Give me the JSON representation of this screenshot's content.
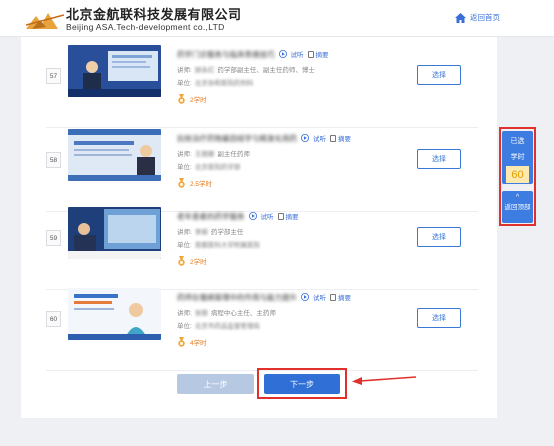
{
  "header": {
    "logo_cn": "北京金航联科技发展有限公司",
    "logo_en": "Beijing ASA.Tech-development co.,LTD",
    "home_label": "返回首页",
    "home_icon": "home-icon"
  },
  "courses": [
    {
      "number": "57",
      "title": "药学门诊服务与临床思维技巧",
      "trial_label": "试听",
      "handout_label": "摘要",
      "lecturer_label": "讲师:",
      "lecturer_name": "顾永红",
      "lecturer_title": "药学部副主任、副主任药师、博士",
      "unit_label": "单位:",
      "unit_name": "北京协和医院药剂科",
      "hours": "2学时",
      "select_label": "选择"
    },
    {
      "number": "58",
      "title": "抗栓治疗药物基因组学与精准化用药",
      "trial_label": "试听",
      "handout_label": "摘要",
      "lecturer_label": "讲师:",
      "lecturer_name": "王丽娜",
      "lecturer_title": "副主任药师",
      "unit_label": "单位:",
      "unit_name": "北京医院药学部",
      "hours": "2.5学时",
      "select_label": "选择"
    },
    {
      "number": "59",
      "title": "老年患者的药学服务",
      "trial_label": "试听",
      "handout_label": "摘要",
      "lecturer_label": "讲师:",
      "lecturer_name": "李娟",
      "lecturer_title": "药学部主任",
      "unit_label": "单位:",
      "unit_name": "首都医科大学附属医院",
      "hours": "2学时",
      "select_label": "选择"
    },
    {
      "number": "60",
      "title": "药师在慢病管理中的作用与能力提升",
      "trial_label": "试听",
      "handout_label": "摘要",
      "lecturer_label": "讲师:",
      "lecturer_name": "张丽",
      "lecturer_title": "病程中心主任、主药师",
      "unit_label": "单位:",
      "unit_name": "北京市药品监督管理局",
      "hours": "4学时",
      "select_label": "选择"
    }
  ],
  "pagination": {
    "prev_label": "上一步",
    "next_label": "下一步"
  },
  "sidebar": {
    "selected_label_1": "已选",
    "selected_label_2": "学时",
    "selected_hours": "60",
    "back_top_caret": "^",
    "back_top_label": "返回顶部"
  },
  "colors": {
    "accent": "#2f6fd6",
    "highlight": "#e0312d",
    "hours": "#e87a1c"
  }
}
